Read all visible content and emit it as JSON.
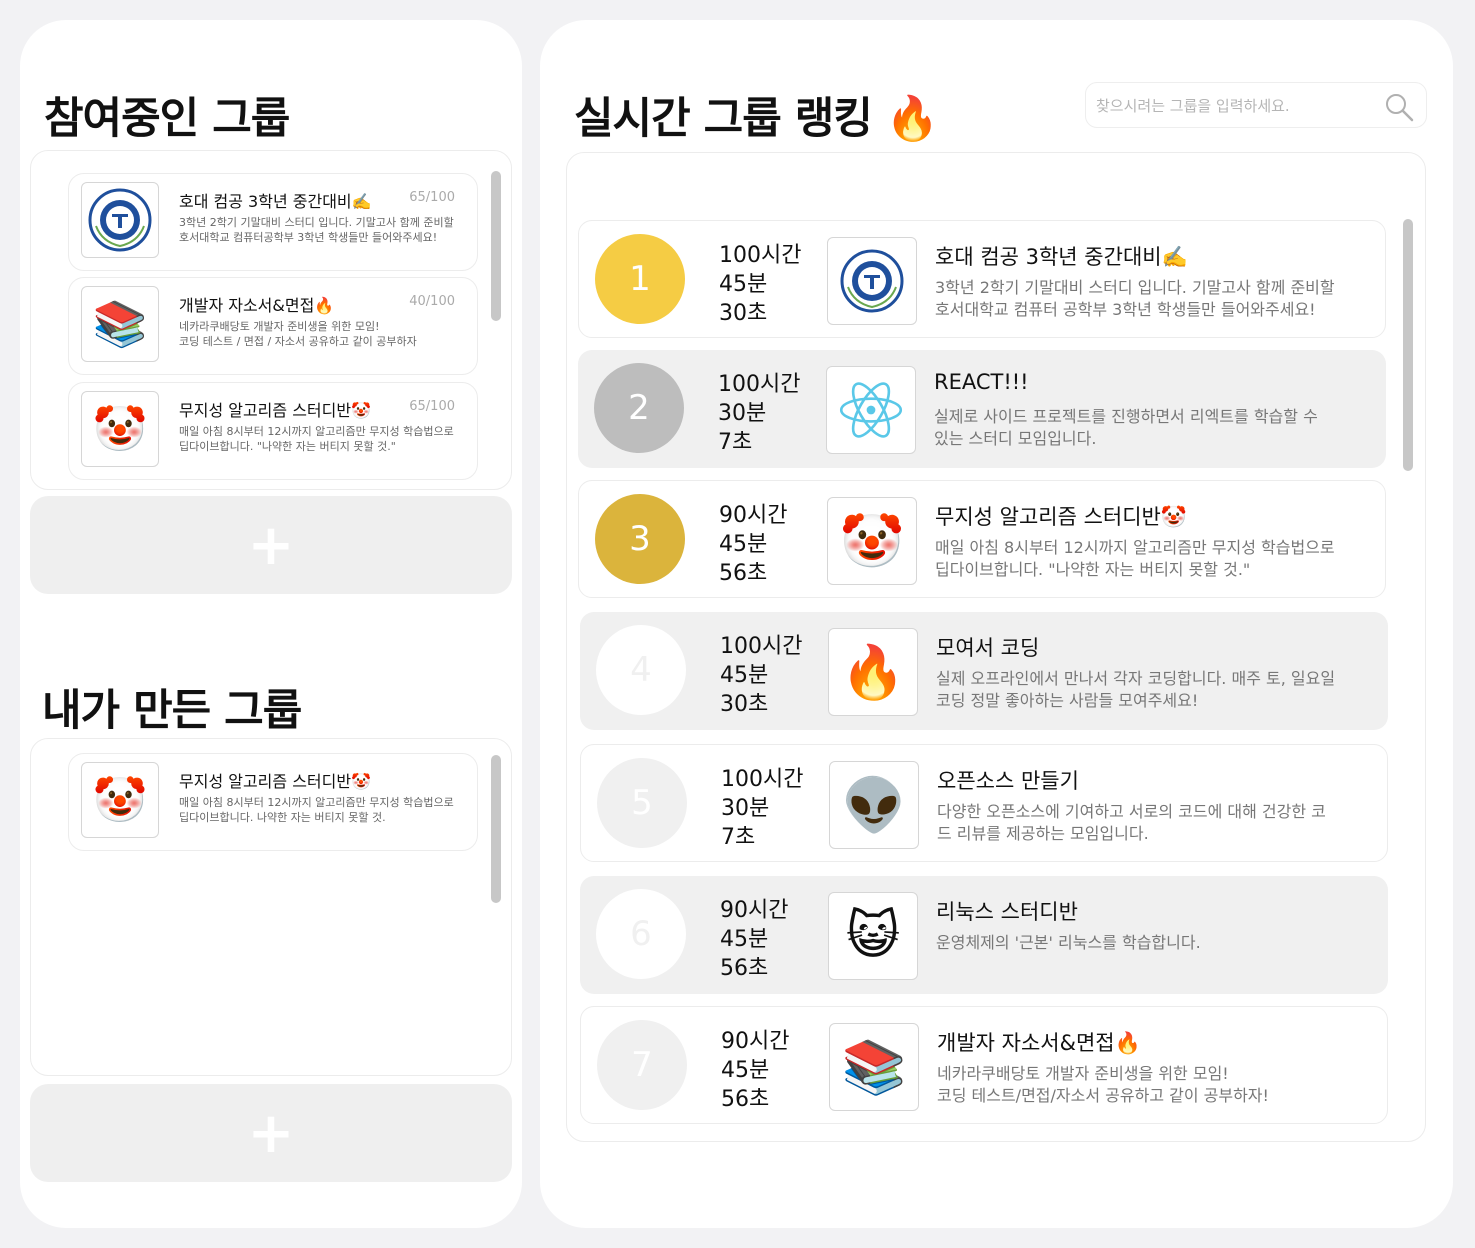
{
  "joined": {
    "title": "참여중인 그룹",
    "groups": [
      {
        "name": "호대 컴공 3학년 중간대비✍️",
        "count": "65/100",
        "desc": "3학년 2학기 기말대비 스터디 입니다. 기말고사 함께 준비할\n호서대학교 컴퓨터공학부 3학년 학생들만 들어와주세요!",
        "icon": "university-emblem-icon"
      },
      {
        "name": "개발자 자소서&면접🔥",
        "count": "40/100",
        "desc": "네카라쿠배당토 개발자 준비생을 위한 모임!\n코딩 테스트 / 면접 / 자소서 공유하고 같이 공부하자",
        "icon": "books-icon"
      },
      {
        "name": "무지성 알고리즘 스터디반🤡",
        "count": "65/100",
        "desc": "매일 아침 8시부터 12시까지 알고리즘만 무지성 학습법으로\n딥다이브합니다. \"나약한 자는 버티지 못할 것.\"",
        "icon": "clown-icon"
      }
    ],
    "add_label": "+"
  },
  "mine": {
    "title": "내가 만든 그룹",
    "groups": [
      {
        "name": "무지성 알고리즘 스터디반🤡",
        "desc": "매일 아침 8시부터 12시까지 알고리즘만 무지성 학습법으로\n딥다이브합니다. 나약한 자는 버티지 못할 것.",
        "icon": "clown-icon"
      }
    ],
    "add_label": "+"
  },
  "ranking": {
    "title": "실시간 그룹 랭킹 🔥",
    "search": {
      "placeholder": "찾으시려는 그룹을 입력하세요.",
      "value": ""
    },
    "items": [
      {
        "rank": "1",
        "time": "100시간\n45분\n30초",
        "name": "호대 컴공 3학년 중간대비✍️",
        "desc": "3학년 2학기 기말대비 스터디 입니다. 기말고사 함께 준비할\n호서대학교 컴퓨터 공학부 3학년 학생들만 들어와주세요!",
        "icon": "university-emblem-icon",
        "circle_color": "#f5cc44"
      },
      {
        "rank": "2",
        "time": "100시간\n30분\n7초",
        "name": "REACT!!!",
        "desc": "실제로 사이드 프로젝트를 진행하면서 리엑트를 학습할 수\n있는 스터디 모임입니다.",
        "icon": "react-atom-icon",
        "circle_color": "#bdbdbd"
      },
      {
        "rank": "3",
        "time": "90시간\n45분\n56초",
        "name": "무지성 알고리즘 스터디반🤡",
        "desc": "매일 아침 8시부터 12시까지 알고리즘만 무지성 학습법으로\n딥다이브합니다. \"나약한 자는 버티지 못할 것.\"",
        "icon": "clown-icon",
        "circle_color": "#dbb43c"
      },
      {
        "rank": "4",
        "time": "100시간\n45분\n30초",
        "name": "모여서 코딩",
        "desc": "실제 오프라인에서 만나서 각자 코딩합니다. 매주 토, 일요일\n코딩 정말 좋아하는 사람들 모여주세요!",
        "icon": "fire-icon",
        "circle_color": "#ffffff"
      },
      {
        "rank": "5",
        "time": "100시간\n30분\n7초",
        "name": "오픈소스 만들기",
        "desc": "다양한 오픈소스에 기여하고 서로의 코드에 대해  건강한 코\n드 리뷰를 제공하는 모임입니다.",
        "icon": "alien-icon",
        "circle_color": "#f0f0f0"
      },
      {
        "rank": "6",
        "time": "90시간\n45분\n56초",
        "name": "리눅스 스터디반",
        "desc": "운영체제의 '근본' 리눅스를 학습합니다.",
        "icon": "cat-icon",
        "circle_color": "#ffffff"
      },
      {
        "rank": "7",
        "time": "90시간\n45분\n56초",
        "name": "개발자 자소서&면접🔥",
        "desc": "네카라쿠배당토 개발자 준비생을 위한 모임!\n코딩 테스트/면접/자소서 공유하고 같이 공부하자!",
        "icon": "books-icon",
        "circle_color": "#f0f0f0"
      }
    ]
  }
}
